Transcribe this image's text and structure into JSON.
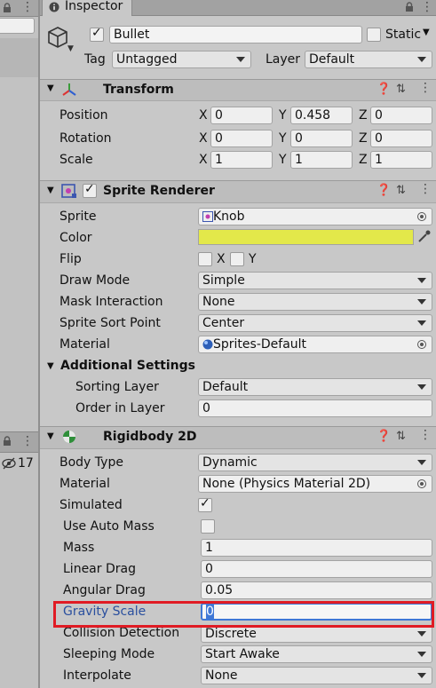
{
  "hierarchy": {
    "visible_count": "17"
  },
  "inspector": {
    "tab_label": "Inspector",
    "object": {
      "active": true,
      "name": "Bullet",
      "static_label": "Static",
      "tag_label": "Tag",
      "tag_value": "Untagged",
      "layer_label": "Layer",
      "layer_value": "Default"
    },
    "transform": {
      "title": "Transform",
      "position": {
        "label": "Position",
        "x": "0",
        "y": "0.458",
        "z": "0"
      },
      "rotation": {
        "label": "Rotation",
        "x": "0",
        "y": "0",
        "z": "0"
      },
      "scale": {
        "label": "Scale",
        "x": "1",
        "y": "1",
        "z": "1"
      },
      "axis_x": "X",
      "axis_y": "Y",
      "axis_z": "Z"
    },
    "sprite_renderer": {
      "title": "Sprite Renderer",
      "enabled": true,
      "sprite_label": "Sprite",
      "sprite_value": "Knob",
      "color_label": "Color",
      "color_value": "#e3e84a",
      "flip_label": "Flip",
      "flip_x": "X",
      "flip_y": "Y",
      "draw_mode_label": "Draw Mode",
      "draw_mode_value": "Simple",
      "mask_label": "Mask Interaction",
      "mask_value": "None",
      "sort_point_label": "Sprite Sort Point",
      "sort_point_value": "Center",
      "material_label": "Material",
      "material_value": "Sprites-Default",
      "additional_settings": "Additional Settings",
      "sorting_layer_label": "Sorting Layer",
      "sorting_layer_value": "Default",
      "order_label": "Order in Layer",
      "order_value": "0"
    },
    "rigidbody2d": {
      "title": "Rigidbody 2D",
      "body_type_label": "Body Type",
      "body_type_value": "Dynamic",
      "material_label": "Material",
      "material_value": "None (Physics Material 2D)",
      "simulated_label": "Simulated",
      "simulated": true,
      "auto_mass_label": "Use Auto Mass",
      "auto_mass": false,
      "mass_label": "Mass",
      "mass_value": "1",
      "linear_drag_label": "Linear Drag",
      "linear_drag_value": "0",
      "angular_drag_label": "Angular Drag",
      "angular_drag_value": "0.05",
      "gravity_label": "Gravity Scale",
      "gravity_value": "0",
      "collision_label": "Collision Detection",
      "collision_value": "Discrete",
      "sleeping_label": "Sleeping Mode",
      "sleeping_value": "Start Awake",
      "interpolate_label": "Interpolate",
      "interpolate_value": "None"
    }
  },
  "colors": {
    "highlight_box": "#e01b24",
    "gravity_label": "#2a4f9e",
    "selection": "#3f78d6",
    "color_swatch": "#e3e84a"
  }
}
